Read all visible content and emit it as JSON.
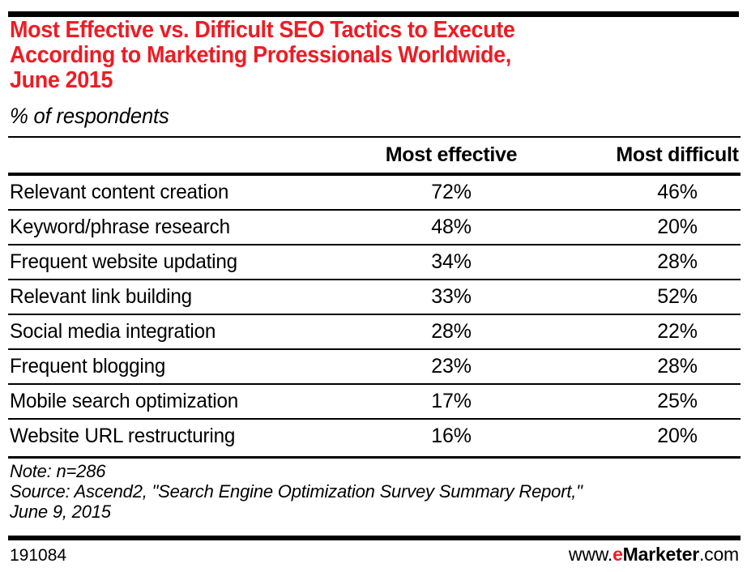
{
  "colors": {
    "title_red": "#ED1C24",
    "text_black": "#000000",
    "background": "#FFFFFF"
  },
  "title": {
    "line1": "Most Effective vs. Difficult SEO Tactics to Execute",
    "line2": "According to Marketing Professionals Worldwide,",
    "line3": "June 2015"
  },
  "subtitle": "% of respondents",
  "chart_data": {
    "type": "table",
    "title": "Most Effective vs. Difficult SEO Tactics to Execute According to Marketing Professionals Worldwide, June 2015",
    "subtitle": "% of respondents",
    "xlabel": "",
    "ylabel": "",
    "columns": [
      "",
      "Most effective",
      "Most difficult"
    ],
    "categories": [
      "Relevant content creation",
      "Keyword/phrase research",
      "Frequent website updating",
      "Relevant link building",
      "Social media integration",
      "Frequent blogging",
      "Mobile search optimization",
      "Website URL restructuring"
    ],
    "series": [
      {
        "name": "Most effective",
        "values": [
          72,
          48,
          34,
          33,
          28,
          23,
          17,
          16
        ]
      },
      {
        "name": "Most difficult",
        "values": [
          46,
          20,
          28,
          52,
          22,
          28,
          25,
          20
        ]
      }
    ],
    "unit": "%",
    "rows": [
      {
        "label": "Relevant content creation",
        "most_effective": "72%",
        "most_difficult": "46%"
      },
      {
        "label": "Keyword/phrase research",
        "most_effective": "48%",
        "most_difficult": "20%"
      },
      {
        "label": "Frequent website updating",
        "most_effective": "34%",
        "most_difficult": "28%"
      },
      {
        "label": "Relevant link building",
        "most_effective": "33%",
        "most_difficult": "52%"
      },
      {
        "label": "Social media integration",
        "most_effective": "28%",
        "most_difficult": "22%"
      },
      {
        "label": "Frequent blogging",
        "most_effective": "23%",
        "most_difficult": "28%"
      },
      {
        "label": "Mobile search optimization",
        "most_effective": "17%",
        "most_difficult": "25%"
      },
      {
        "label": "Website URL restructuring",
        "most_effective": "16%",
        "most_difficult": "20%"
      }
    ]
  },
  "table": {
    "header": {
      "label_col": "",
      "most_effective": "Most effective",
      "most_difficult": "Most difficult"
    }
  },
  "notes": {
    "line1": "Note: n=286",
    "line2": "Source: Ascend2, \"Search Engine Optimization Survey Summary Report,\"",
    "line3": "June 9, 2015"
  },
  "footer": {
    "id": "191084",
    "brand_www": "www.",
    "brand_e": "e",
    "brand_marketer": "Marketer",
    "brand_com": ".com"
  }
}
